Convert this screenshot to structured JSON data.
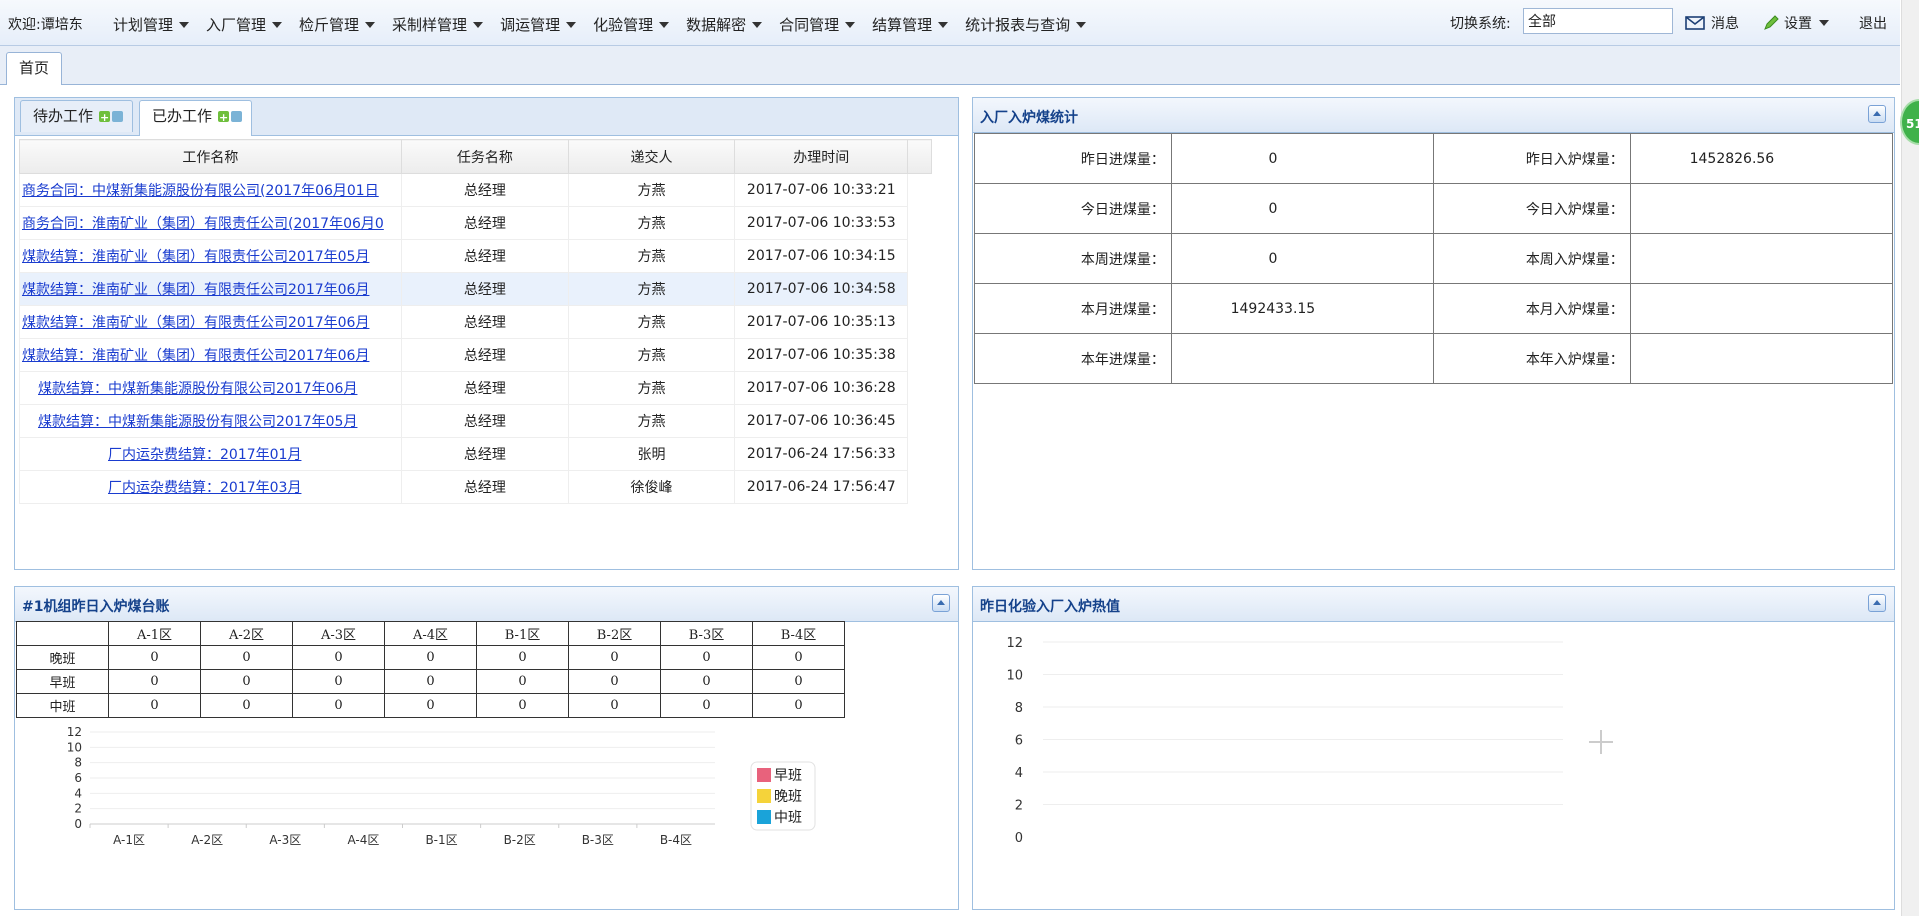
{
  "topbar": {
    "welcome": "欢迎:谭培东",
    "menus": [
      "计划管理",
      "入厂管理",
      "检斤管理",
      "采制样管理",
      "调运管理",
      "化验管理",
      "数据解密",
      "合同管理",
      "结算管理",
      "统计报表与查询"
    ],
    "switch_label": "切换系统:",
    "switch_value": "全部",
    "messages_label": "消息",
    "settings_label": "设置",
    "logout_label": "退出"
  },
  "tabs": {
    "home": "首页"
  },
  "work": {
    "tab_todo": "待办工作",
    "tab_done": "已办工作",
    "columns": [
      "工作名称",
      "任务名称",
      "递交人",
      "办理时间"
    ],
    "rows": [
      {
        "name": "商务合同：中煤新集能源股份有限公司(2017年06月01日",
        "task": "总经理",
        "submitter": "方燕",
        "time": "2017-07-06 10:33:21",
        "indent": 0
      },
      {
        "name": "商务合同：淮南矿业（集团）有限责任公司(2017年06月0",
        "task": "总经理",
        "submitter": "方燕",
        "time": "2017-07-06 10:33:53",
        "indent": 0
      },
      {
        "name": "煤款结算：淮南矿业（集团）有限责任公司2017年05月",
        "task": "总经理",
        "submitter": "方燕",
        "time": "2017-07-06 10:34:15",
        "indent": 0
      },
      {
        "name": "煤款结算：淮南矿业（集团）有限责任公司2017年06月",
        "task": "总经理",
        "submitter": "方燕",
        "time": "2017-07-06 10:34:58",
        "indent": 0
      },
      {
        "name": "煤款结算：淮南矿业（集团）有限责任公司2017年06月",
        "task": "总经理",
        "submitter": "方燕",
        "time": "2017-07-06 10:35:13",
        "indent": 0
      },
      {
        "name": "煤款结算：淮南矿业（集团）有限责任公司2017年06月",
        "task": "总经理",
        "submitter": "方燕",
        "time": "2017-07-06 10:35:38",
        "indent": 0
      },
      {
        "name": "煤款结算：中煤新集能源股份有限公司2017年06月",
        "task": "总经理",
        "submitter": "方燕",
        "time": "2017-07-06 10:36:28",
        "indent": 1
      },
      {
        "name": "煤款结算：中煤新集能源股份有限公司2017年05月",
        "task": "总经理",
        "submitter": "方燕",
        "time": "2017-07-06 10:36:45",
        "indent": 1
      },
      {
        "name": "厂内运杂费结算：2017年01月",
        "task": "总经理",
        "submitter": "张明",
        "time": "2017-06-24 17:56:33",
        "indent": 2
      },
      {
        "name": "厂内运杂费结算：2017年03月",
        "task": "总经理",
        "submitter": "徐俊峰",
        "time": "2017-06-24 17:56:47",
        "indent": 2
      }
    ]
  },
  "stats": {
    "title": "入厂入炉煤统计",
    "rows": [
      {
        "l1": "昨日进煤量：",
        "v1": "0",
        "l2": "昨日入炉煤量：",
        "v2": "1452826.56"
      },
      {
        "l1": "今日进煤量：",
        "v1": "0",
        "l2": "今日入炉煤量：",
        "v2": ""
      },
      {
        "l1": "本周进煤量：",
        "v1": "0",
        "l2": "本周入炉煤量：",
        "v2": ""
      },
      {
        "l1": "本月进煤量：",
        "v1": "1492433.15",
        "l2": "本月入炉煤量：",
        "v2": ""
      },
      {
        "l1": "本年进煤量：",
        "v1": "",
        "l2": "本年入炉煤量：",
        "v2": ""
      }
    ]
  },
  "ledger": {
    "title": "#1机组昨日入炉煤台账",
    "zones": [
      "A-1区",
      "A-2区",
      "A-3区",
      "A-4区",
      "B-1区",
      "B-2区",
      "B-3区",
      "B-4区"
    ],
    "shifts": [
      {
        "name": "晚班",
        "values": [
          "0",
          "0",
          "0",
          "0",
          "0",
          "0",
          "0",
          "0"
        ]
      },
      {
        "name": "早班",
        "values": [
          "0",
          "0",
          "0",
          "0",
          "0",
          "0",
          "0",
          "0"
        ]
      },
      {
        "name": "中班",
        "values": [
          "0",
          "0",
          "0",
          "0",
          "0",
          "0",
          "0",
          "0"
        ]
      }
    ]
  },
  "heat": {
    "title": "昨日化验入厂入炉热值"
  },
  "badge": "51",
  "colors": {
    "early": "#e8627c",
    "late": "#f5d33a",
    "mid": "#1aa3d9"
  },
  "chart_data": [
    {
      "type": "bar",
      "categories": [
        "A-1区",
        "A-2区",
        "A-3区",
        "A-4区",
        "B-1区",
        "B-2区",
        "B-3区",
        "B-4区"
      ],
      "series": [
        {
          "name": "早班",
          "values": [
            0,
            0,
            0,
            0,
            0,
            0,
            0,
            0
          ]
        },
        {
          "name": "晚班",
          "values": [
            0,
            0,
            0,
            0,
            0,
            0,
            0,
            0
          ]
        },
        {
          "name": "中班",
          "values": [
            0,
            0,
            0,
            0,
            0,
            0,
            0,
            0
          ]
        }
      ],
      "yticks": [
        0,
        2,
        4,
        6,
        8,
        10,
        12
      ],
      "ylim": [
        0,
        12
      ],
      "legend": "right"
    },
    {
      "type": "line",
      "categories": [],
      "series": [],
      "yticks": [
        0,
        2,
        4,
        6,
        8,
        10,
        12
      ],
      "ylim": [
        0,
        12
      ]
    }
  ]
}
